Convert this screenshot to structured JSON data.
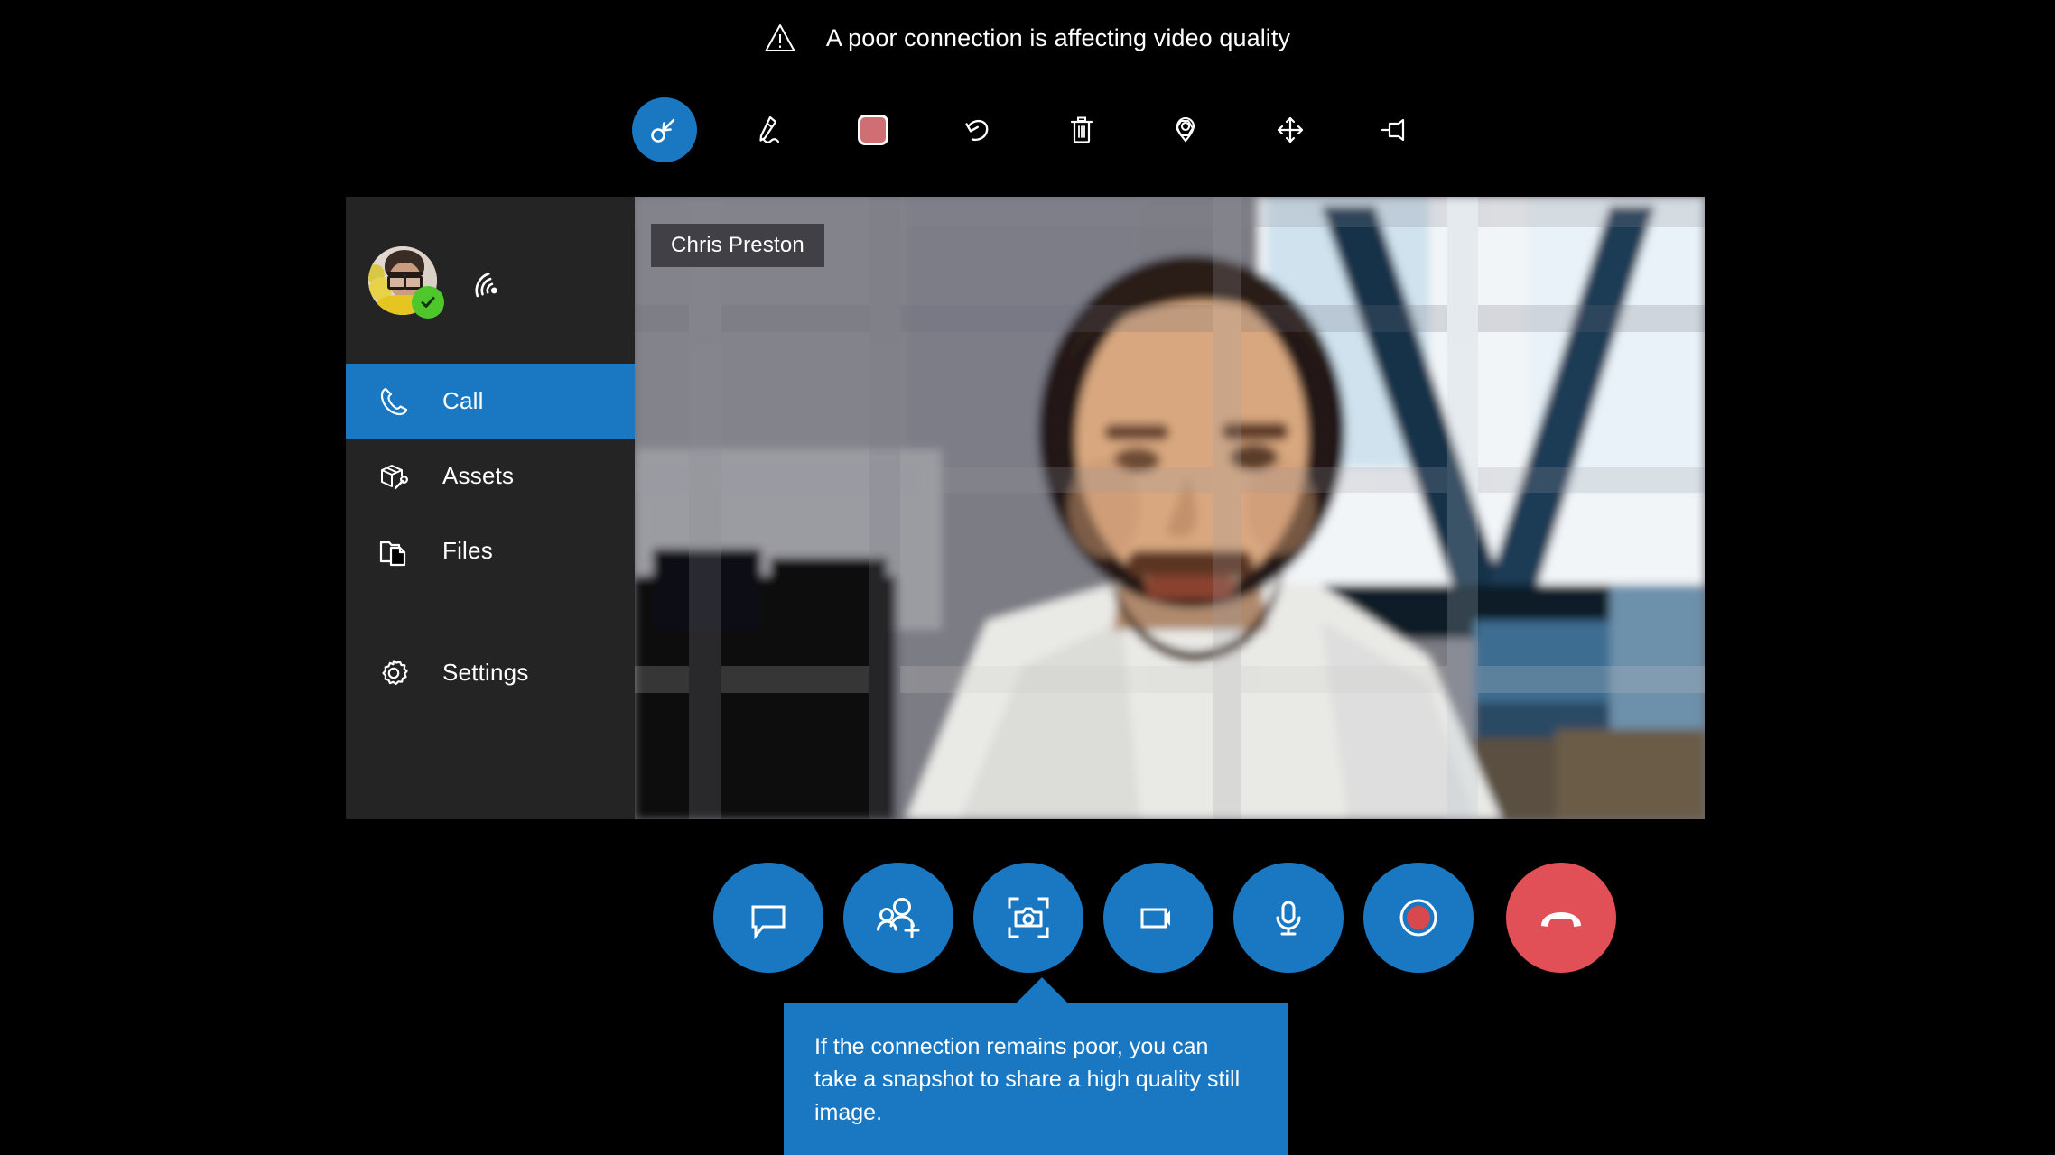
{
  "warning": {
    "icon": "warning-triangle-icon",
    "text": "A poor connection is affecting video quality"
  },
  "annotation_toolbar": {
    "items": [
      {
        "name": "select-arrow-icon",
        "label": "Select",
        "active": true
      },
      {
        "name": "ink-pen-icon",
        "label": "Ink",
        "active": false
      },
      {
        "name": "color-swatch-icon",
        "label": "Color",
        "active": false,
        "color": "#cf6e73"
      },
      {
        "name": "undo-icon",
        "label": "Undo",
        "active": false
      },
      {
        "name": "delete-trash-icon",
        "label": "Delete all",
        "active": false
      },
      {
        "name": "place-anchor-icon",
        "label": "Anchor",
        "active": false
      },
      {
        "name": "move-arrows-icon",
        "label": "Move",
        "active": false
      },
      {
        "name": "pin-icon",
        "label": "Pin",
        "active": false
      }
    ]
  },
  "sidebar": {
    "profile": {
      "avatar_name": "avatar",
      "status": "available",
      "status_icon": "check-badge-icon",
      "signal_icon": "signal-strength-icon"
    },
    "items": [
      {
        "label": "Call",
        "icon": "phone-icon",
        "active": true
      },
      {
        "label": "Assets",
        "icon": "assets-box-wrench-icon",
        "active": false
      },
      {
        "label": "Files",
        "icon": "files-folder-icon",
        "active": false
      },
      {
        "label": "Settings",
        "icon": "gear-icon",
        "active": false
      }
    ]
  },
  "video": {
    "participant_name": "Chris Preston"
  },
  "call_controls": [
    {
      "name": "chat-button",
      "icon": "chat-bubble-icon",
      "label": "Chat",
      "style": "primary"
    },
    {
      "name": "add-participant-button",
      "icon": "add-people-icon",
      "label": "Add people",
      "style": "primary"
    },
    {
      "name": "snapshot-button",
      "icon": "snapshot-camera-icon",
      "label": "Snapshot",
      "style": "primary"
    },
    {
      "name": "video-toggle-button",
      "icon": "video-camera-icon",
      "label": "Video",
      "style": "primary"
    },
    {
      "name": "mute-button",
      "icon": "microphone-icon",
      "label": "Mute",
      "style": "primary"
    },
    {
      "name": "record-button",
      "icon": "record-icon",
      "label": "Record",
      "style": "primary"
    },
    {
      "name": "end-call-button",
      "icon": "end-call-handset-icon",
      "label": "End call",
      "style": "danger"
    }
  ],
  "tooltip": {
    "text": "If the connection remains poor, you can take a snapshot to share a high quality still image."
  },
  "colors": {
    "accent_blue": "#1a78c2",
    "danger_red": "#e14f57",
    "record_red": "#d8494f",
    "sidebar_bg": "#242424",
    "app_bg": "#000000",
    "status_green": "#4ec72b",
    "swatch_red": "#cf6e73"
  }
}
